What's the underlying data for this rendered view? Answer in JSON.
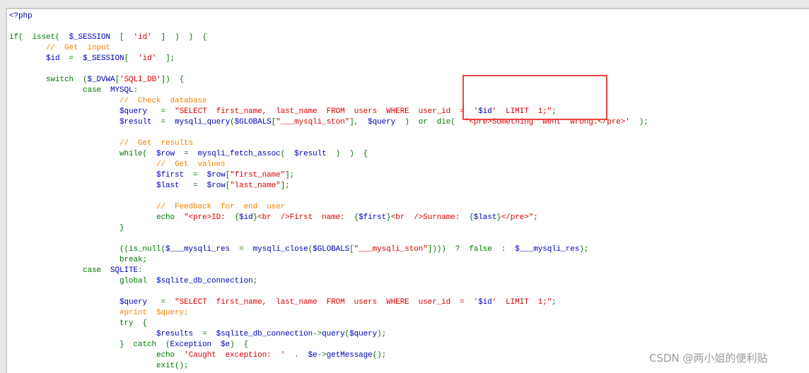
{
  "colors": {
    "keyword": "#007700",
    "variable": "#0000BB",
    "string": "#DD0000",
    "comment": "#FF8000",
    "highlight_box": "#F04040"
  },
  "watermark": "CSDN @两小姐的便利贴",
  "code_lines": [
    {
      "indent": 0,
      "tokens": [
        [
          "v",
          "<?php"
        ]
      ]
    },
    {
      "indent": 0,
      "tokens": []
    },
    {
      "indent": 0,
      "tokens": [
        [
          "k",
          "if(  isset(  "
        ],
        [
          "v",
          "$_SESSION  "
        ],
        [
          "k",
          "[  "
        ],
        [
          "s",
          "'id'  "
        ],
        [
          "k",
          "]  )  )  {"
        ]
      ]
    },
    {
      "indent": 1,
      "tokens": [
        [
          "c",
          "//  Get  input"
        ]
      ]
    },
    {
      "indent": 1,
      "tokens": [
        [
          "v",
          "$id  "
        ],
        [
          "k",
          "=  "
        ],
        [
          "v",
          "$_SESSION"
        ],
        [
          "k",
          "[  "
        ],
        [
          "s",
          "'id'  "
        ],
        [
          "k",
          "];"
        ]
      ]
    },
    {
      "indent": 0,
      "tokens": []
    },
    {
      "indent": 1,
      "tokens": [
        [
          "k",
          "switch  ("
        ],
        [
          "v",
          "$_DVWA"
        ],
        [
          "k",
          "["
        ],
        [
          "s",
          "'SQLI_DB'"
        ],
        [
          "k",
          "])  {"
        ]
      ]
    },
    {
      "indent": 2,
      "tokens": [
        [
          "k",
          "case  "
        ],
        [
          "v",
          "MYSQL"
        ],
        [
          "k",
          ":"
        ]
      ]
    },
    {
      "indent": 3,
      "tokens": [
        [
          "c",
          "//  Check  database"
        ]
      ]
    },
    {
      "indent": 3,
      "tokens": [
        [
          "v",
          "$query   "
        ],
        [
          "k",
          "=  "
        ],
        [
          "s",
          "\"SELECT  first_name,  last_name  FROM  users  WHERE  user_id  =  '"
        ],
        [
          "v",
          "$id"
        ],
        [
          "s",
          "'  LIMIT  1;\""
        ],
        [
          "k",
          ";"
        ]
      ]
    },
    {
      "indent": 3,
      "tokens": [
        [
          "v",
          "$result  "
        ],
        [
          "k",
          "=  "
        ],
        [
          "v",
          "mysqli_query"
        ],
        [
          "k",
          "("
        ],
        [
          "v",
          "$GLOBALS"
        ],
        [
          "k",
          "["
        ],
        [
          "s",
          "\"___mysqli_ston\""
        ],
        [
          "k",
          "],  "
        ],
        [
          "v",
          "$query  "
        ],
        [
          "k",
          ")  or  die(  "
        ],
        [
          "s",
          "'<pre>Something  went  wrong.</pre>'  "
        ],
        [
          "k",
          ");"
        ]
      ]
    },
    {
      "indent": 0,
      "tokens": []
    },
    {
      "indent": 3,
      "tokens": [
        [
          "c",
          "//  Get  results"
        ]
      ]
    },
    {
      "indent": 3,
      "tokens": [
        [
          "k",
          "while(  "
        ],
        [
          "v",
          "$row  "
        ],
        [
          "k",
          "=  "
        ],
        [
          "v",
          "mysqli_fetch_assoc"
        ],
        [
          "k",
          "(  "
        ],
        [
          "v",
          "$result  "
        ],
        [
          "k",
          ")  )  {"
        ]
      ]
    },
    {
      "indent": 4,
      "tokens": [
        [
          "c",
          "//  Get  values"
        ]
      ]
    },
    {
      "indent": 4,
      "tokens": [
        [
          "v",
          "$first  "
        ],
        [
          "k",
          "=  "
        ],
        [
          "v",
          "$row"
        ],
        [
          "k",
          "["
        ],
        [
          "s",
          "\"first_name\""
        ],
        [
          "k",
          "];"
        ]
      ]
    },
    {
      "indent": 4,
      "tokens": [
        [
          "v",
          "$last   "
        ],
        [
          "k",
          "=  "
        ],
        [
          "v",
          "$row"
        ],
        [
          "k",
          "["
        ],
        [
          "s",
          "\"last_name\""
        ],
        [
          "k",
          "];"
        ]
      ]
    },
    {
      "indent": 0,
      "tokens": []
    },
    {
      "indent": 4,
      "tokens": [
        [
          "c",
          "//  Feedback  for  end  user"
        ]
      ]
    },
    {
      "indent": 4,
      "tokens": [
        [
          "k",
          "echo  "
        ],
        [
          "s",
          "\"<pre>ID:  "
        ],
        [
          "k",
          "{"
        ],
        [
          "v",
          "$id"
        ],
        [
          "k",
          "}"
        ],
        [
          "s",
          "<br  />First  name:  "
        ],
        [
          "k",
          "{"
        ],
        [
          "v",
          "$first"
        ],
        [
          "k",
          "}"
        ],
        [
          "s",
          "<br  />Surname:  "
        ],
        [
          "k",
          "{"
        ],
        [
          "v",
          "$last"
        ],
        [
          "k",
          "}"
        ],
        [
          "s",
          "</pre>\""
        ],
        [
          "k",
          ";"
        ]
      ]
    },
    {
      "indent": 3,
      "tokens": [
        [
          "k",
          "}"
        ]
      ]
    },
    {
      "indent": 0,
      "tokens": []
    },
    {
      "indent": 3,
      "tokens": [
        [
          "k",
          "((is_null("
        ],
        [
          "v",
          "$___mysqli_res  "
        ],
        [
          "k",
          "=  "
        ],
        [
          "v",
          "mysqli_close"
        ],
        [
          "k",
          "("
        ],
        [
          "v",
          "$GLOBALS"
        ],
        [
          "k",
          "["
        ],
        [
          "s",
          "\"___mysqli_ston\""
        ],
        [
          "k",
          "])))  ?  false  :  "
        ],
        [
          "v",
          "$___mysqli_res"
        ],
        [
          "k",
          ");"
        ]
      ]
    },
    {
      "indent": 3,
      "tokens": [
        [
          "k",
          "break;"
        ]
      ]
    },
    {
      "indent": 2,
      "tokens": [
        [
          "k",
          "case  "
        ],
        [
          "v",
          "SQLITE"
        ],
        [
          "k",
          ":"
        ]
      ]
    },
    {
      "indent": 3,
      "tokens": [
        [
          "k",
          "global  "
        ],
        [
          "v",
          "$sqlite_db_connection"
        ],
        [
          "k",
          ";"
        ]
      ]
    },
    {
      "indent": 0,
      "tokens": []
    },
    {
      "indent": 3,
      "tokens": [
        [
          "v",
          "$query   "
        ],
        [
          "k",
          "=  "
        ],
        [
          "s",
          "\"SELECT  first_name,  last_name  FROM  users  WHERE  user_id  =  '"
        ],
        [
          "v",
          "$id"
        ],
        [
          "s",
          "'  LIMIT  1;\""
        ],
        [
          "k",
          ";"
        ]
      ]
    },
    {
      "indent": 3,
      "tokens": [
        [
          "c",
          "#print  $query;"
        ]
      ]
    },
    {
      "indent": 3,
      "tokens": [
        [
          "k",
          "try  {"
        ]
      ]
    },
    {
      "indent": 4,
      "tokens": [
        [
          "v",
          "$results  "
        ],
        [
          "k",
          "=  "
        ],
        [
          "v",
          "$sqlite_db_connection"
        ],
        [
          "k",
          "->"
        ],
        [
          "v",
          "query"
        ],
        [
          "k",
          "("
        ],
        [
          "v",
          "$query"
        ],
        [
          "k",
          ");"
        ]
      ]
    },
    {
      "indent": 3,
      "tokens": [
        [
          "k",
          "}  catch  ("
        ],
        [
          "v",
          "Exception  $e"
        ],
        [
          "k",
          ")  {"
        ]
      ]
    },
    {
      "indent": 4,
      "tokens": [
        [
          "k",
          "echo  "
        ],
        [
          "s",
          "'Caught  exception:  '  "
        ],
        [
          "k",
          ".  "
        ],
        [
          "v",
          "$e"
        ],
        [
          "k",
          "->"
        ],
        [
          "v",
          "getMessage"
        ],
        [
          "k",
          "();"
        ]
      ]
    },
    {
      "indent": 4,
      "tokens": [
        [
          "k",
          "exit();"
        ]
      ]
    }
  ]
}
